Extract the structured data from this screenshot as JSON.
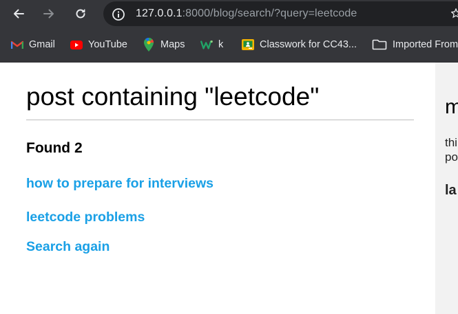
{
  "browser": {
    "url_host": "127.0.0.1",
    "url_path": ":8000/blog/search/?query=leetcode",
    "icons": [
      "back-arrow-icon",
      "forward-arrow-icon",
      "reload-icon",
      "site-info-icon",
      "star-icon"
    ]
  },
  "bookmarks": [
    {
      "label": "Gmail",
      "icon": "gmail-icon",
      "color": "#ea4335"
    },
    {
      "label": "YouTube",
      "icon": "youtube-icon",
      "color": "#ff0000"
    },
    {
      "label": "Maps",
      "icon": "maps-icon",
      "color": "#34a853"
    },
    {
      "label": "k",
      "icon": "w-icon",
      "color": "#21a366"
    },
    {
      "label": "Classwork for CC43...",
      "icon": "classroom-icon",
      "color": "#f4b400"
    },
    {
      "label": "Imported From",
      "icon": "folder-icon",
      "color": "#e8eaed"
    }
  ],
  "page": {
    "title": "post containing \"leetcode\"",
    "found_text": "Found 2",
    "results": [
      {
        "label": "how to prepare for interviews"
      },
      {
        "label": "leetcode problems"
      }
    ],
    "search_again": "Search again",
    "link_color": "#1aa0e6"
  },
  "sidebar": {
    "heading": "m",
    "text": "thi\npo",
    "subheading": "la"
  }
}
